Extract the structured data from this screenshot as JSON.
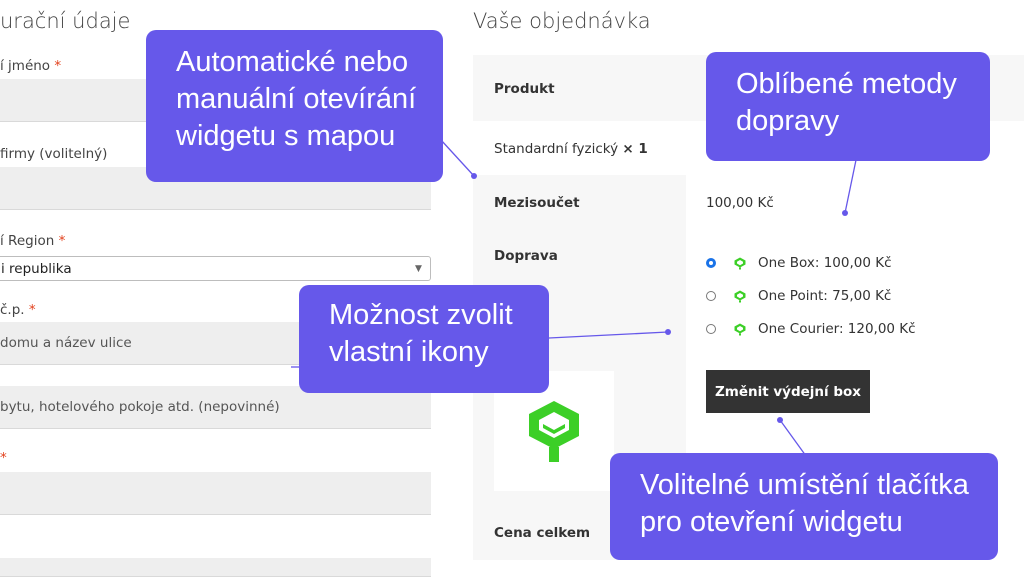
{
  "billing": {
    "title": "urační údaje",
    "first_name_label": "í jméno",
    "company_label": "firmy (volitelný)",
    "region_label": "í Region",
    "region_value": "i republika",
    "street_label": "č.p.",
    "street_placeholder": "domu a název ulice",
    "street2_placeholder": "bytu, hotelového pokoje atd. (nepovinné)",
    "required_mark": "*"
  },
  "order": {
    "title": "Vaše objednávka",
    "product_header": "Produkt",
    "product_name": "Standardní fyzický",
    "product_qty": "× 1",
    "subtotal_label": "Mezisoučet",
    "subtotal_value": "100,00 Kč",
    "shipping_label": "Doprava",
    "shipping_options": [
      {
        "label": "One Box: 100,00 Kč",
        "selected": true
      },
      {
        "label": "One Point: 75,00 Kč",
        "selected": false
      },
      {
        "label": "One Courier: 120,00 Kč",
        "selected": false
      }
    ],
    "change_box_button": "Změnit výdejní box",
    "total_label": "Cena celkem",
    "shipping_icon_color": "#3ccf27"
  },
  "callouts": {
    "widget_open": [
      "Automatické nebo",
      "manuální otevírání",
      "widgetu s mapou"
    ],
    "favorite_methods": [
      "Oblíbené metody",
      "dopravy"
    ],
    "custom_icons": [
      "Možnost zvolit",
      "vlastní ikony"
    ],
    "button_placement": [
      "Volitelné umístění tlačítka",
      "pro otevření widgetu"
    ],
    "color": "#6658ea"
  }
}
